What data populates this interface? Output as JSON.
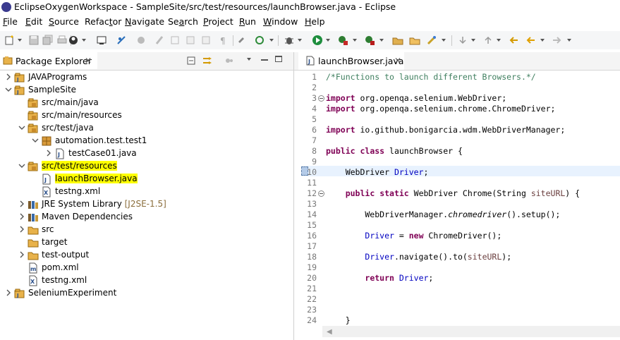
{
  "window": {
    "title": "EclipseOxygenWorkspace - SampleSite/src/test/resources/launchBrowser.java - Eclipse"
  },
  "menu": [
    "File",
    "Edit",
    "Source",
    "Refactor",
    "Navigate",
    "Search",
    "Project",
    "Run",
    "Window",
    "Help"
  ],
  "menu_mnemonics": [
    "F",
    "E",
    "S",
    "t",
    "N",
    "a",
    "P",
    "R",
    "W",
    "H"
  ],
  "package_explorer": {
    "tab_label": "Package Explorer",
    "close_glyph": "✕",
    "tree": [
      {
        "label": "JAVAPrograms",
        "depth": 0,
        "arrow": "right",
        "icon": "java-project-icon"
      },
      {
        "label": "SampleSite",
        "depth": 0,
        "arrow": "down",
        "icon": "java-project-icon"
      },
      {
        "label": "src/main/java",
        "depth": 1,
        "arrow": "none",
        "icon": "package-folder-icon"
      },
      {
        "label": "src/main/resources",
        "depth": 1,
        "arrow": "none",
        "icon": "package-folder-icon"
      },
      {
        "label": "src/test/java",
        "depth": 1,
        "arrow": "down",
        "icon": "package-folder-icon"
      },
      {
        "label": "automation.test.test1",
        "depth": 2,
        "arrow": "down",
        "icon": "package-icon"
      },
      {
        "label": "testCase01.java",
        "depth": 3,
        "arrow": "right",
        "icon": "java-file-icon"
      },
      {
        "label": "src/test/resources",
        "depth": 1,
        "arrow": "down",
        "icon": "package-folder-icon",
        "highlight": true
      },
      {
        "label": "launchBrowser.java",
        "depth": 2,
        "arrow": "none",
        "icon": "java-file-icon",
        "highlight": true
      },
      {
        "label": "testng.xml",
        "depth": 2,
        "arrow": "none",
        "icon": "xml-file-icon"
      },
      {
        "label": "JRE System Library",
        "decoration": "[J2SE-1.5]",
        "depth": 1,
        "arrow": "right",
        "icon": "library-icon"
      },
      {
        "label": "Maven Dependencies",
        "depth": 1,
        "arrow": "right",
        "icon": "library-icon"
      },
      {
        "label": "src",
        "depth": 1,
        "arrow": "right",
        "icon": "folder-icon"
      },
      {
        "label": "target",
        "depth": 1,
        "arrow": "none",
        "icon": "folder-icon"
      },
      {
        "label": "test-output",
        "depth": 1,
        "arrow": "right",
        "icon": "folder-icon"
      },
      {
        "label": "pom.xml",
        "depth": 1,
        "arrow": "none",
        "icon": "maven-file-icon"
      },
      {
        "label": "testng.xml",
        "depth": 1,
        "arrow": "none",
        "icon": "xml-file-icon"
      },
      {
        "label": "SeleniumExperiment",
        "depth": 0,
        "arrow": "right",
        "icon": "java-project-icon"
      }
    ]
  },
  "editor": {
    "tab_label": "launchBrowser.java",
    "close_glyph": "✕",
    "lines": [
      {
        "n": "1",
        "code": "/*Functions to launch different Browsers.*/"
      },
      {
        "n": "2",
        "code": ""
      },
      {
        "n": "3",
        "code": "import org.openqa.selenium.WebDriver;"
      },
      {
        "n": "4",
        "code": "import org.openqa.selenium.chrome.ChromeDriver;"
      },
      {
        "n": "5",
        "code": ""
      },
      {
        "n": "6",
        "code": "import io.github.bonigarcia.wdm.WebDriverManager;"
      },
      {
        "n": "7",
        "code": ""
      },
      {
        "n": "8",
        "code": "public class launchBrowser {"
      },
      {
        "n": "9",
        "code": ""
      },
      {
        "n": "10",
        "code": "    WebDriver Driver;"
      },
      {
        "n": "11",
        "code": ""
      },
      {
        "n": "12",
        "code": "    public static WebDriver Chrome(String siteURL) {"
      },
      {
        "n": "13",
        "code": ""
      },
      {
        "n": "14",
        "code": "        WebDriverManager.chromedriver().setup();"
      },
      {
        "n": "15",
        "code": ""
      },
      {
        "n": "16",
        "code": "        Driver = new ChromeDriver();"
      },
      {
        "n": "17",
        "code": ""
      },
      {
        "n": "18",
        "code": "        Driver.navigate().to(siteURL);"
      },
      {
        "n": "19",
        "code": ""
      },
      {
        "n": "20",
        "code": "        return Driver;"
      },
      {
        "n": "21",
        "code": ""
      },
      {
        "n": "22",
        "code": ""
      },
      {
        "n": "23",
        "code": ""
      },
      {
        "n": "24",
        "code": "    }"
      }
    ]
  },
  "colors": {
    "highlight": "#ffff00",
    "keyword": "#7f0055",
    "comment": "#3f7f5f",
    "field": "#0000c0"
  }
}
